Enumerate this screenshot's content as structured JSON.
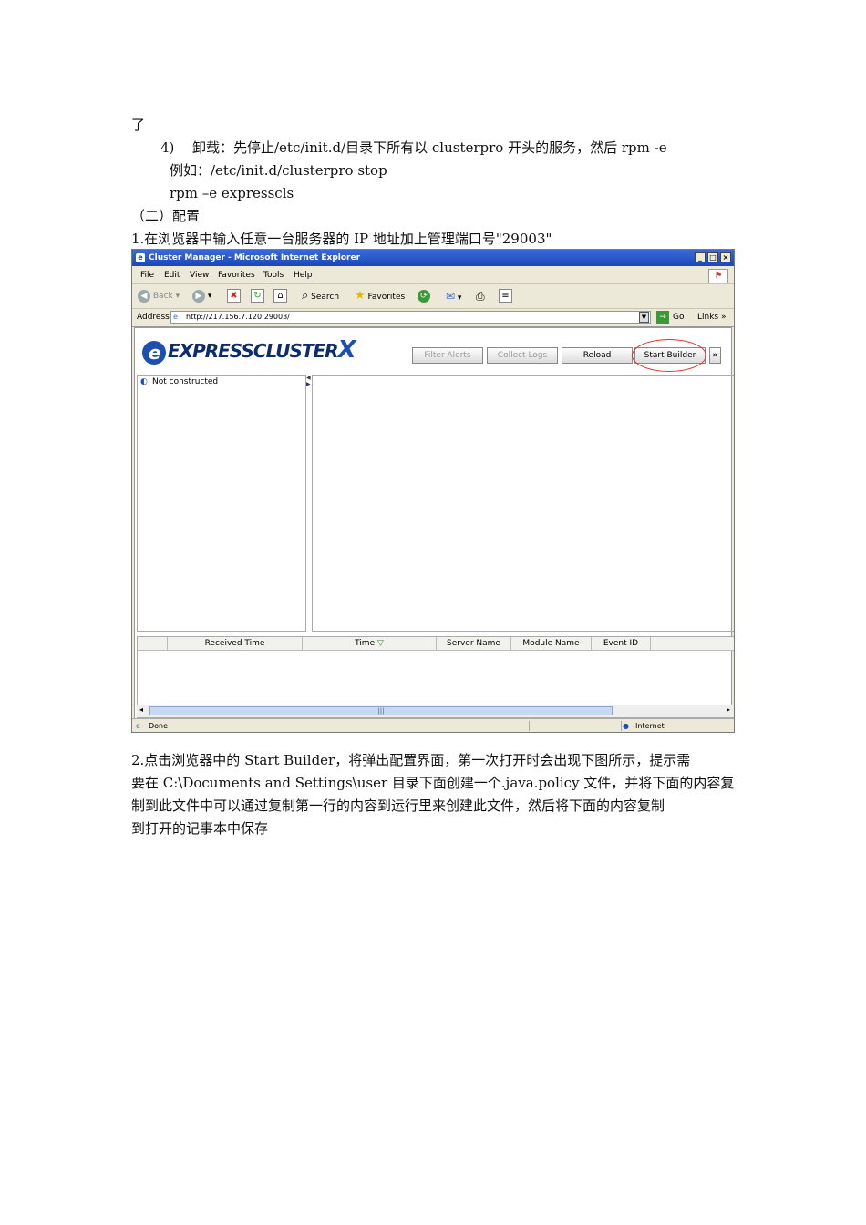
{
  "doc": {
    "line_liao": "了",
    "step4_num": "4)",
    "step4_text": "卸载：先停止/etc/init.d/目录下所有以 clusterpro 开头的服务，然后 rpm  -e",
    "example": "例如：/etc/init.d/clusterpro  stop",
    "rpm_cmd": "rpm –e expresscls",
    "section_config": "（二）配置",
    "step1": "1.在浏览器中输入任意一台服务器的 IP 地址加上管理端口号\"29003\"",
    "para2": [
      "2.点击浏览器中的 Start Builder，将弹出配置界面，第一次打开时会出现下图所示，提示需",
      "要在 C:\\Documents and Settings\\user 目录下面创建一个.java.policy 文件，并将下面的内容复",
      "制到此文件中可以通过复制第一行的内容到运行里来创建此文件，然后将下面的内容复制",
      "到打开的记事本中保存"
    ]
  },
  "browser": {
    "title": "Cluster Manager - Microsoft Internet Explorer",
    "menu": [
      "File",
      "Edit",
      "View",
      "Favorites",
      "Tools",
      "Help"
    ],
    "toolbar": {
      "back": "Back",
      "search": "Search",
      "favorites": "Favorites"
    },
    "address_label": "Address",
    "address_value": "http://217.156.7.120:29003/",
    "go_label": "Go",
    "links_label": "Links",
    "status_done": "Done",
    "status_zone": "Internet"
  },
  "app": {
    "logo_text": "EXPRESSCLUSTER",
    "logo_x": "X",
    "buttons": [
      "Filter Alerts",
      "Collect Logs",
      "Reload",
      "Start Builder"
    ],
    "more": "»",
    "tree_status": "Not constructed",
    "columns": [
      "Received Time",
      "Time",
      "Server Name",
      "Module Name",
      "Event ID"
    ]
  },
  "colors": {
    "title_bar": "#1b47b9",
    "highlight_ring": "#e03030"
  }
}
